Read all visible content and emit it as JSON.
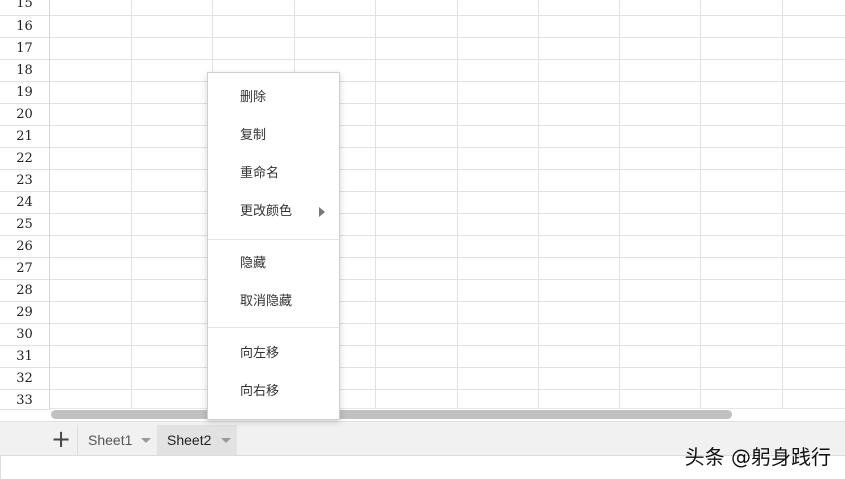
{
  "grid": {
    "row_numbers": [
      "15",
      "16",
      "17",
      "18",
      "19",
      "20",
      "21",
      "22",
      "23",
      "24",
      "25",
      "26",
      "27",
      "28",
      "29",
      "30",
      "31",
      "32",
      "33"
    ]
  },
  "tabbar": {
    "add_button": "+",
    "tabs": [
      {
        "label": "Sheet1",
        "active": false
      },
      {
        "label": "Sheet2",
        "active": true
      }
    ]
  },
  "context_menu": {
    "items": [
      {
        "label": "删除"
      },
      {
        "label": "复制"
      },
      {
        "label": "重命名"
      },
      {
        "label": "更改颜色",
        "submenu_icon": "triangle-right-icon"
      },
      {
        "label": "隐藏"
      },
      {
        "label": "取消隐藏"
      },
      {
        "label": "向左移"
      },
      {
        "label": "向右移"
      }
    ]
  },
  "watermark": {
    "text": "头条 @躬身践行"
  },
  "colors": {
    "grid_line": "#e2e2e2",
    "tabbar_bg": "#f1f1f1",
    "active_tab_bg": "#e2e2e2",
    "scroll_thumb": "#c1c1c1",
    "menu_text": "#333333"
  }
}
